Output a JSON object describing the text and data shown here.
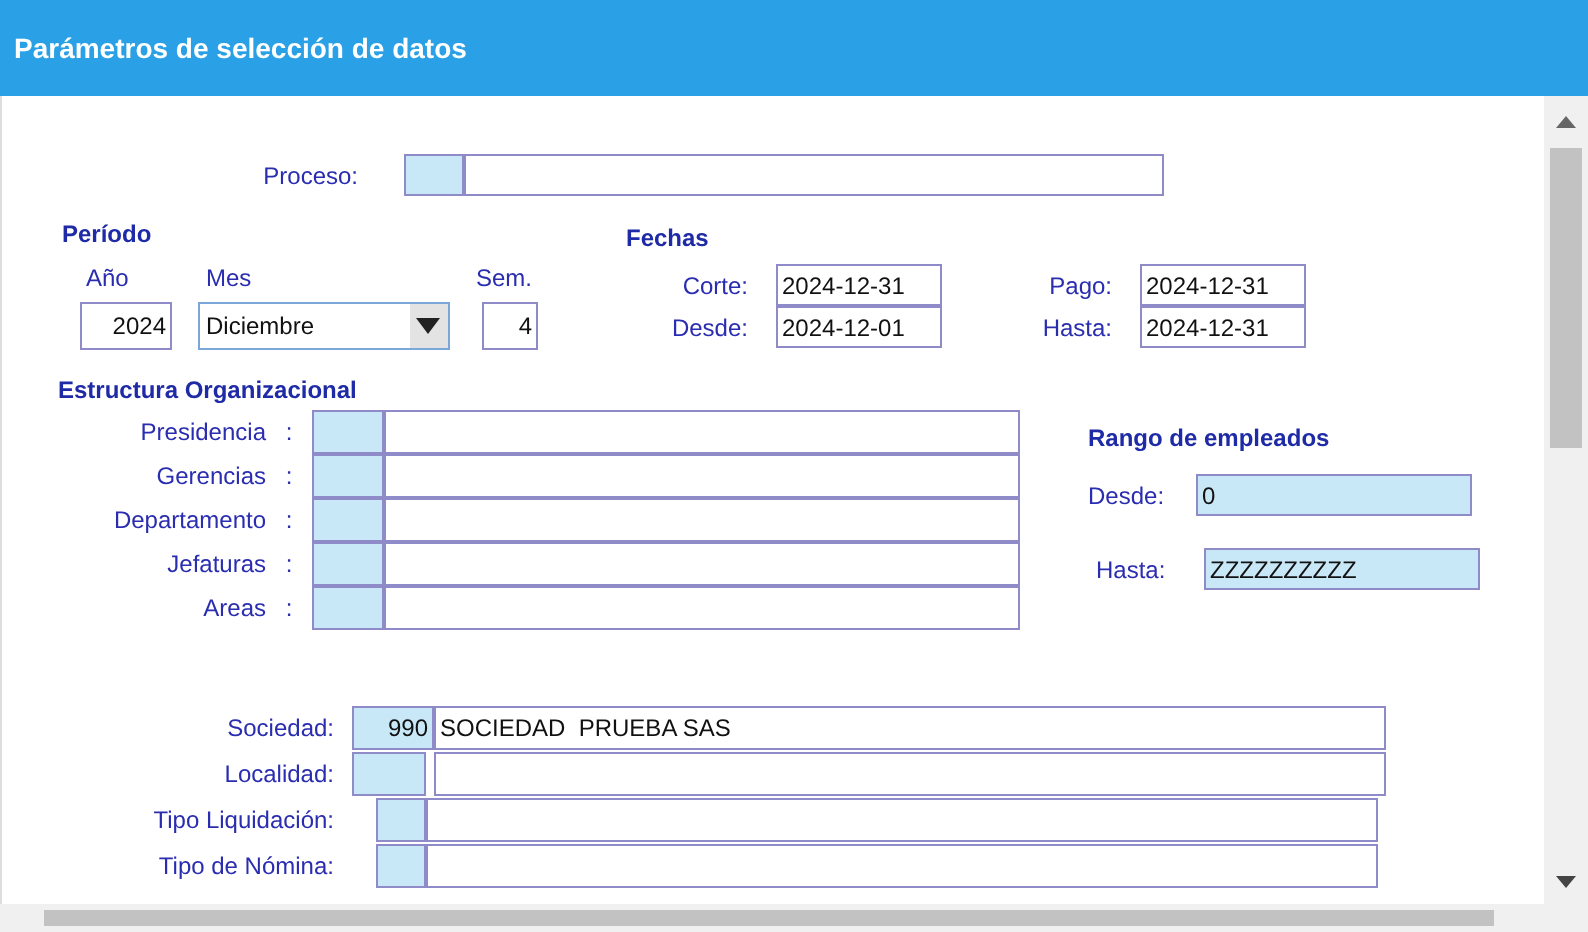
{
  "window": {
    "title": "Parámetros de selección de datos"
  },
  "proceso": {
    "label": "Proceso:"
  },
  "periodo": {
    "title": "Período",
    "year_label": "Año",
    "year": "2024",
    "month_label": "Mes",
    "month": "Diciembre",
    "week_label": "Sem.",
    "week": "4"
  },
  "fechas": {
    "title": "Fechas",
    "fields": [
      {
        "label": "Corte:",
        "value": "2024-12-31"
      },
      {
        "label": "Pago:",
        "value": "2024-12-31"
      },
      {
        "label": "Desde:",
        "value": "2024-12-01"
      },
      {
        "label": "Hasta:",
        "value": "2024-12-31"
      }
    ]
  },
  "estructura": {
    "title": "Estructura Organizacional",
    "rows": [
      {
        "label": "Presidencia",
        "separator": ":"
      },
      {
        "label": "Gerencias",
        "separator": ":"
      },
      {
        "label": "Departamento",
        "separator": ":"
      },
      {
        "label": "Jefaturas",
        "separator": ":"
      },
      {
        "label": "Areas",
        "separator": ":"
      }
    ]
  },
  "rango": {
    "title": "Rango de empleados",
    "from_label": "Desde:",
    "from": "0",
    "to_label": "Hasta:",
    "to": "ZZZZZZZZZZ"
  },
  "empresa": [
    {
      "label": "Sociedad:",
      "code": "990",
      "description": "SOCIEDAD  PRUEBA SAS",
      "kind": "wide"
    },
    {
      "label": "Localidad:",
      "kind": "wide"
    },
    {
      "label": "Tipo Liquidación:",
      "kind": "narrow"
    },
    {
      "label": "Tipo de Nómina:",
      "kind": "narrow"
    }
  ]
}
